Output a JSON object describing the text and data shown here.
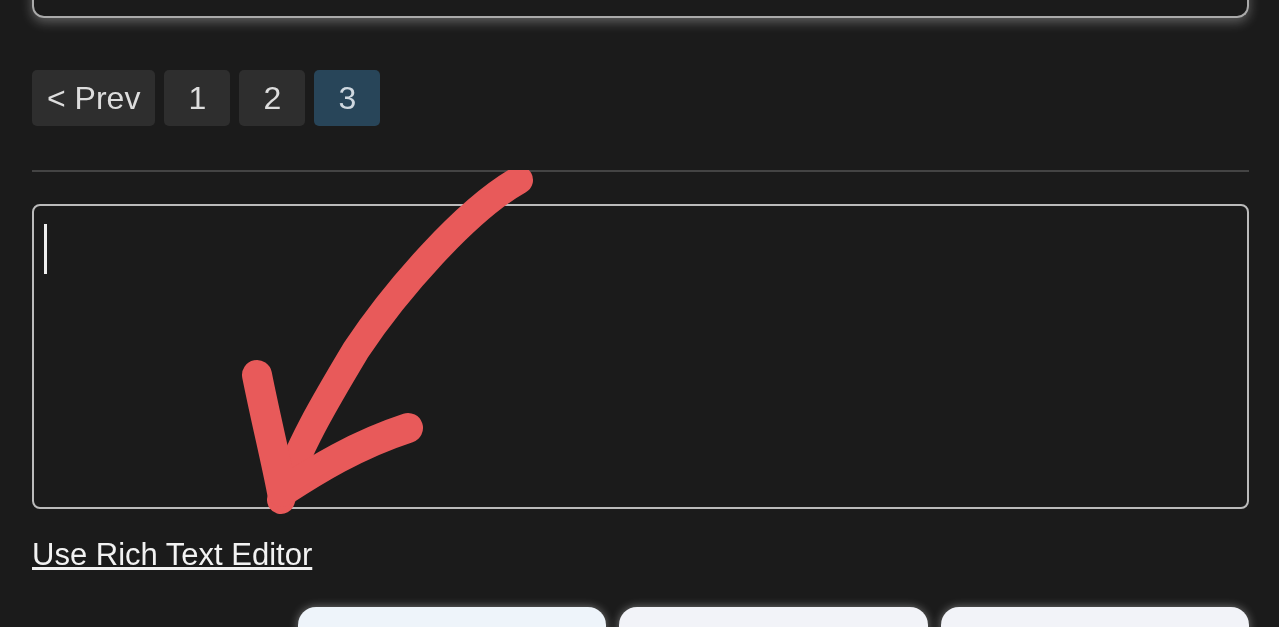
{
  "pagination": [
    {
      "label": "< Prev",
      "selected": false
    },
    {
      "label": "1",
      "selected": false
    },
    {
      "label": "2",
      "selected": false
    },
    {
      "label": "3",
      "selected": true
    }
  ],
  "editor_link": "Use Rich Text Editor"
}
